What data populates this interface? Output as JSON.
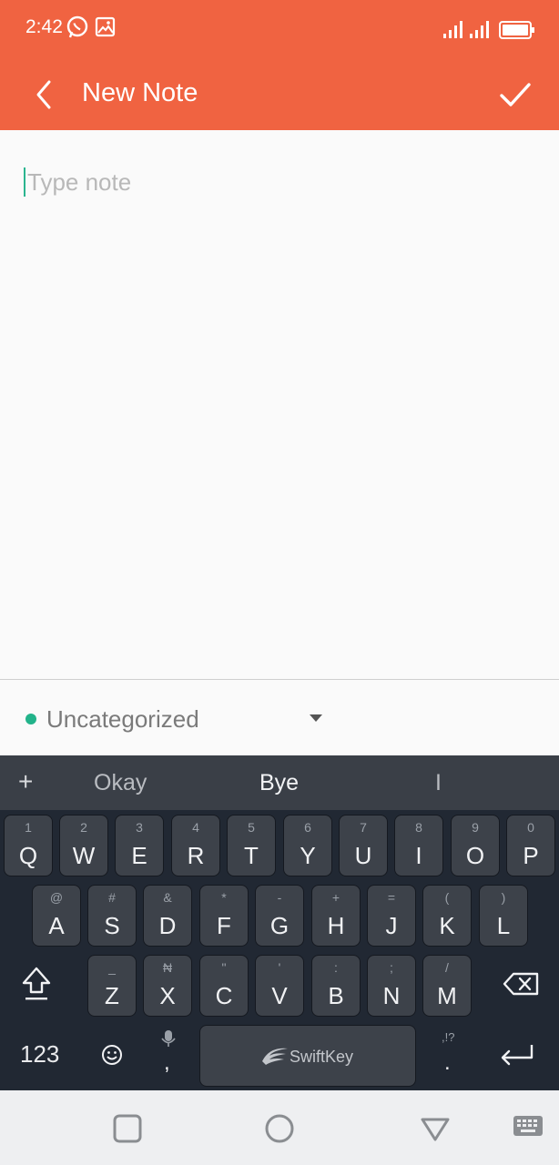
{
  "status_bar": {
    "time": "2:42"
  },
  "app_bar": {
    "title": "New Note"
  },
  "editor": {
    "placeholder": "Type note",
    "value": ""
  },
  "category": {
    "label": "Uncategorized",
    "dot_color": "#22b38a"
  },
  "keyboard": {
    "suggestions": [
      "Okay",
      "Bye",
      "I"
    ],
    "plus": "+",
    "row1": [
      {
        "hint": "1",
        "key": "Q"
      },
      {
        "hint": "2",
        "key": "W"
      },
      {
        "hint": "3",
        "key": "E"
      },
      {
        "hint": "4",
        "key": "R"
      },
      {
        "hint": "5",
        "key": "T"
      },
      {
        "hint": "6",
        "key": "Y"
      },
      {
        "hint": "7",
        "key": "U"
      },
      {
        "hint": "8",
        "key": "I"
      },
      {
        "hint": "9",
        "key": "O"
      },
      {
        "hint": "0",
        "key": "P"
      }
    ],
    "row2": [
      {
        "hint": "@",
        "key": "A"
      },
      {
        "hint": "#",
        "key": "S"
      },
      {
        "hint": "&",
        "key": "D"
      },
      {
        "hint": "*",
        "key": "F"
      },
      {
        "hint": "-",
        "key": "G"
      },
      {
        "hint": "+",
        "key": "H"
      },
      {
        "hint": "=",
        "key": "J"
      },
      {
        "hint": "(",
        "key": "K"
      },
      {
        "hint": ")",
        "key": "L"
      }
    ],
    "row3": [
      {
        "hint": "_",
        "key": "Z"
      },
      {
        "hint": "₦",
        "key": "X"
      },
      {
        "hint": "\"",
        "key": "C"
      },
      {
        "hint": "'",
        "key": "V"
      },
      {
        "hint": ":",
        "key": "B"
      },
      {
        "hint": ";",
        "key": "N"
      },
      {
        "hint": "/",
        "key": "M"
      }
    ],
    "num_label": "123",
    "comma": ",",
    "period": ".",
    "punct_hint": ",!?",
    "space_label": "SwiftKey"
  },
  "colors": {
    "accent": "#f06341",
    "keyboard_bg": "#212833",
    "key_bg": "#3d424a"
  }
}
